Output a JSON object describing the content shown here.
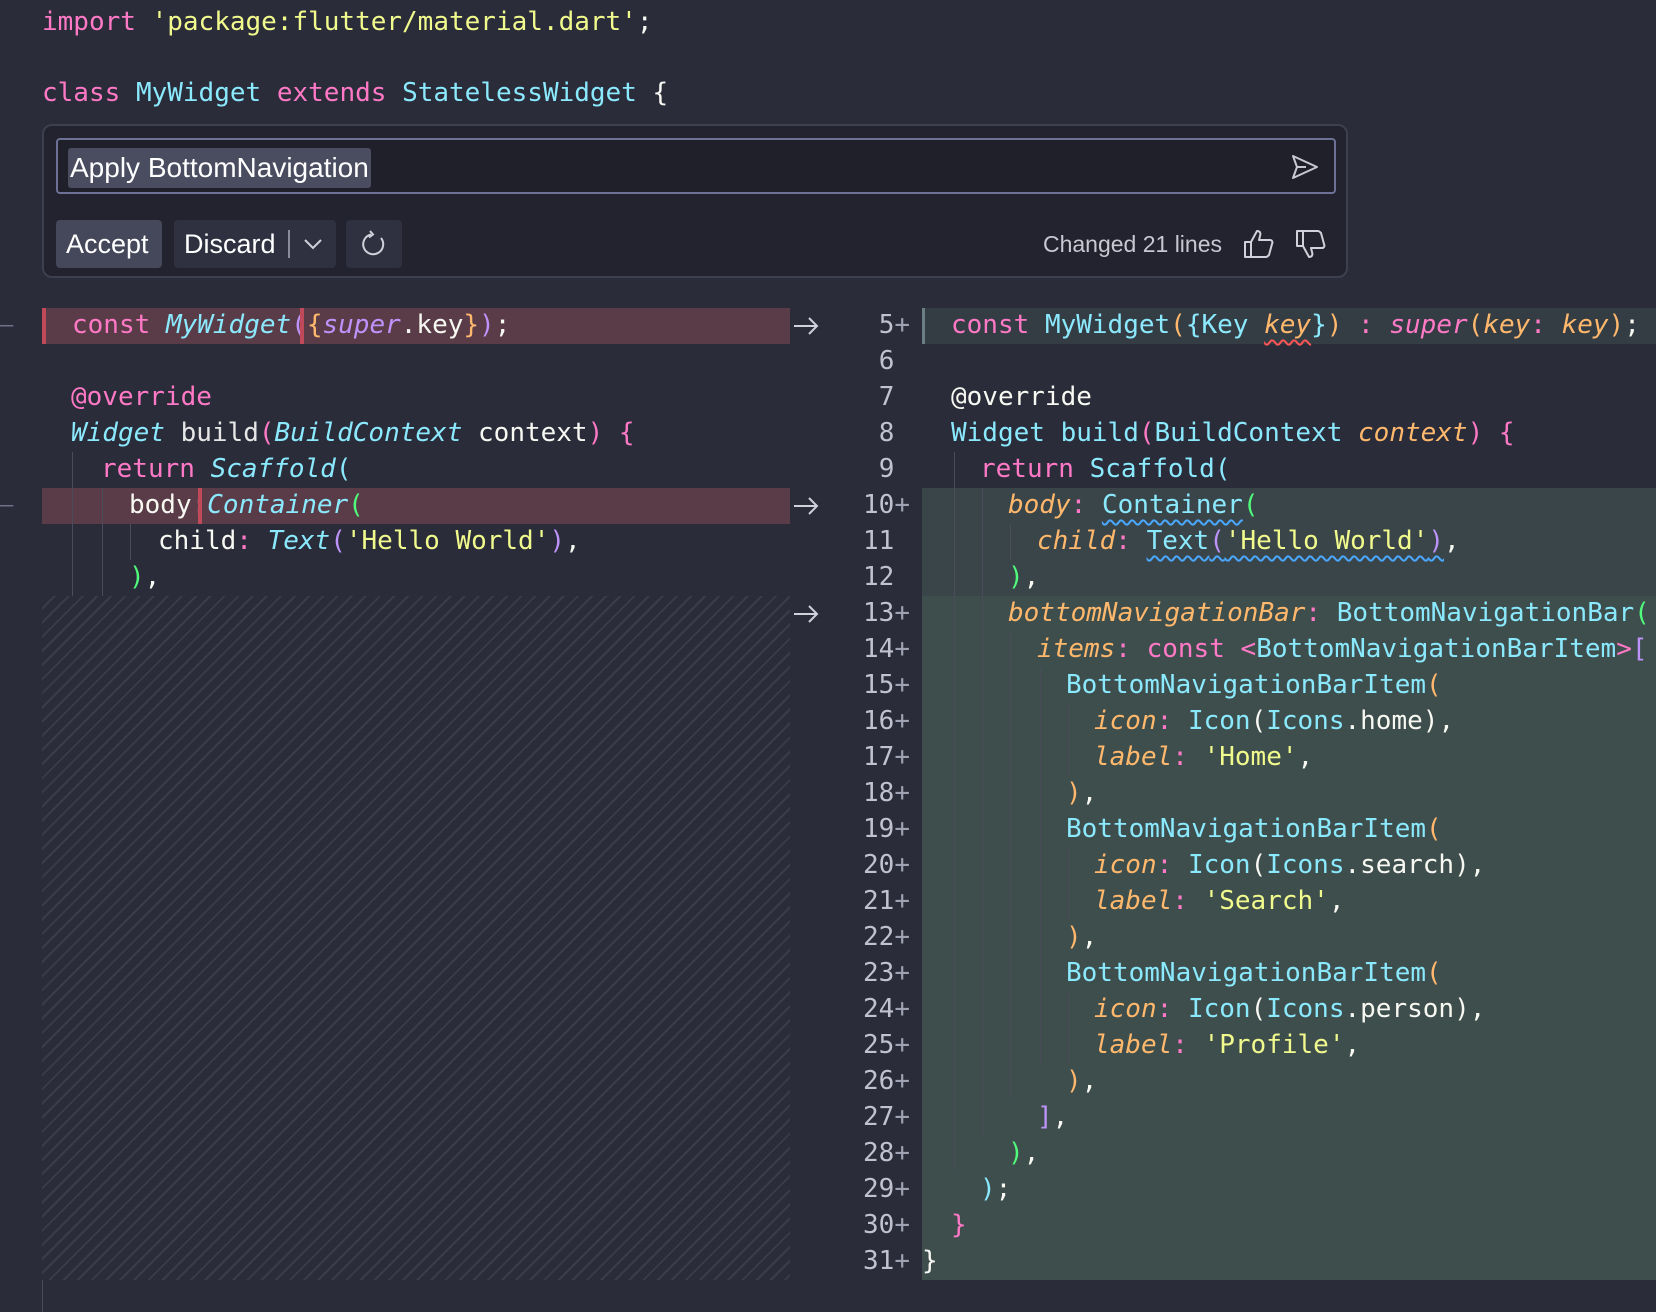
{
  "top_code": {
    "line1": {
      "kw": "import",
      "str": "'package:flutter/material.dart'",
      "end": ";"
    },
    "line2": {
      "kw": "class",
      "name": "MyWidget",
      "kw2": "extends",
      "base": "StatelessWidget",
      "brace": "{"
    }
  },
  "widget": {
    "prompt_text": "Apply BottomNavigation",
    "accept_label": "Accept",
    "discard_label": "Discard",
    "changed_text": "Changed 21 lines"
  },
  "left": {
    "l1": {
      "kw": "const",
      "name": "MyWidget",
      "open": "(",
      "brace": "{",
      "sup": "super",
      "rest": ".key",
      "close_b": "}",
      "close_p": ")",
      "end": ";"
    },
    "l2": "@override",
    "l3": {
      "typ": "Widget",
      "fn": "build",
      "open": "(",
      "arg_t": "BuildContext",
      "arg": "context",
      "close": ")",
      "brace": "{"
    },
    "l4": {
      "kw": "return",
      "cls": "Scaffold",
      "open": "("
    },
    "l5": {
      "key": "body",
      "colon": ":",
      "cls": "Container",
      "open": "("
    },
    "l6": {
      "key": "child",
      "colon": ":",
      "cls": "Text",
      "open": "(",
      "str": "'Hello World'",
      "close": ")",
      "end": ","
    },
    "l7": {
      "close": ")",
      "end": ","
    }
  },
  "line_numbers": [
    "5+",
    "6",
    "7",
    "8",
    "9",
    "10+",
    "11",
    "12",
    "13+",
    "14+",
    "15+",
    "16+",
    "17+",
    "18+",
    "19+",
    "20+",
    "21+",
    "22+",
    "23+",
    "24+",
    "25+",
    "26+",
    "27+",
    "28+",
    "29+",
    "30+",
    "31+"
  ],
  "right": {
    "r5": {
      "kw": "const",
      "name": "MyWidget",
      "open": "(",
      "brace": "{",
      "typ": "Key",
      "key": "key",
      "close_b": "}",
      "close_p": ")",
      "colon": " : ",
      "sup": "super",
      "open2": "(",
      "key2": "key",
      "colon2": ":",
      "val": "key",
      "close2": ")",
      "end": ";"
    },
    "r7": "@override",
    "r8": {
      "typ": "Widget",
      "fn": "build",
      "open": "(",
      "arg_t": "BuildContext",
      "arg": "context",
      "close": ")",
      "brace": "{"
    },
    "r9": {
      "kw": "return",
      "cls": "Scaffold",
      "open": "("
    },
    "r10": {
      "key": "body",
      "colon": ":",
      "cls": "Container",
      "open": "("
    },
    "r11": {
      "key": "child",
      "colon": ":",
      "cls": "Text",
      "open": "(",
      "str": "'Hello World'",
      "close": ")",
      "end": ","
    },
    "r12": {
      "close": ")",
      "end": ","
    },
    "r13": {
      "key": "bottomNavigationBar",
      "colon": ":",
      "cls": "BottomNavigationBar",
      "open": "("
    },
    "r14": {
      "key": "items",
      "colon": ":",
      "kw": "const",
      "lt": "<",
      "typ": "BottomNavigationBarItem",
      "gt": ">",
      "open": "["
    },
    "r15": {
      "cls": "BottomNavigationBarItem",
      "open": "("
    },
    "r16": {
      "key": "icon",
      "colon": ":",
      "cls": "Icon",
      "open": "(",
      "cls2": "Icons",
      "prop": ".home",
      "close": ")",
      "end": ","
    },
    "r17": {
      "key": "label",
      "colon": ":",
      "str": "'Home'",
      "end": ","
    },
    "r18": {
      "close": ")",
      "end": ","
    },
    "r19": {
      "cls": "BottomNavigationBarItem",
      "open": "("
    },
    "r20": {
      "key": "icon",
      "colon": ":",
      "cls": "Icon",
      "open": "(",
      "cls2": "Icons",
      "prop": ".search",
      "close": ")",
      "end": ","
    },
    "r21": {
      "key": "label",
      "colon": ":",
      "str": "'Search'",
      "end": ","
    },
    "r22": {
      "close": ")",
      "end": ","
    },
    "r23": {
      "cls": "BottomNavigationBarItem",
      "open": "("
    },
    "r24": {
      "key": "icon",
      "colon": ":",
      "cls": "Icon",
      "open": "(",
      "cls2": "Icons",
      "prop": ".person",
      "close": ")",
      "end": ","
    },
    "r25": {
      "key": "label",
      "colon": ":",
      "str": "'Profile'",
      "end": ","
    },
    "r26": {
      "close": ")",
      "end": ","
    },
    "r27": {
      "close": "]",
      "end": ","
    },
    "r28": {
      "close": ")",
      "end": ","
    },
    "r29": {
      "close": ")",
      "end": ";"
    },
    "r30": "}",
    "r31": "}"
  },
  "colors": {
    "background": "#2a2c39",
    "removed_line": "#5a3c48",
    "added_block": "#3e4e4d",
    "keyword": "#ff79c6",
    "string": "#f1fa8c",
    "class": "#8be9fd",
    "parameter": "#ffb86c"
  },
  "icons": [
    "send-icon",
    "chevron-down-icon",
    "refresh-icon",
    "thumbs-up-icon",
    "thumbs-down-icon",
    "arrow-right-icon"
  ]
}
